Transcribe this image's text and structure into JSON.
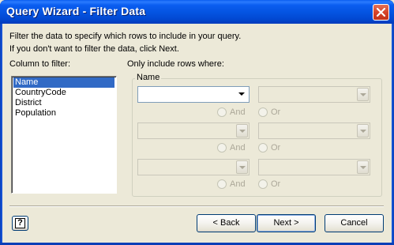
{
  "window": {
    "title": "Query Wizard - Filter Data"
  },
  "instructions": {
    "line1": "Filter the data to specify which rows to include in your query.",
    "line2": "If you don't want to filter the data, click Next."
  },
  "columns": {
    "label": "Column to filter:",
    "items": [
      "Name",
      "CountryCode",
      "District",
      "Population"
    ],
    "selected": "Name"
  },
  "filter": {
    "label": "Only include rows where:",
    "group_label": "Name",
    "rows": [
      {
        "operator": "",
        "value": "",
        "and_label": "And",
        "or_label": "Or"
      },
      {
        "operator": "",
        "value": "",
        "and_label": "And",
        "or_label": "Or"
      },
      {
        "operator": "",
        "value": "",
        "and_label": "And",
        "or_label": "Or"
      }
    ]
  },
  "buttons": {
    "back": "< Back",
    "next": "Next >",
    "cancel": "Cancel",
    "help": "?"
  },
  "colors": {
    "titlebar": "#0453e0",
    "selection": "#316ac5",
    "dialog_bg": "#ece9d8"
  }
}
